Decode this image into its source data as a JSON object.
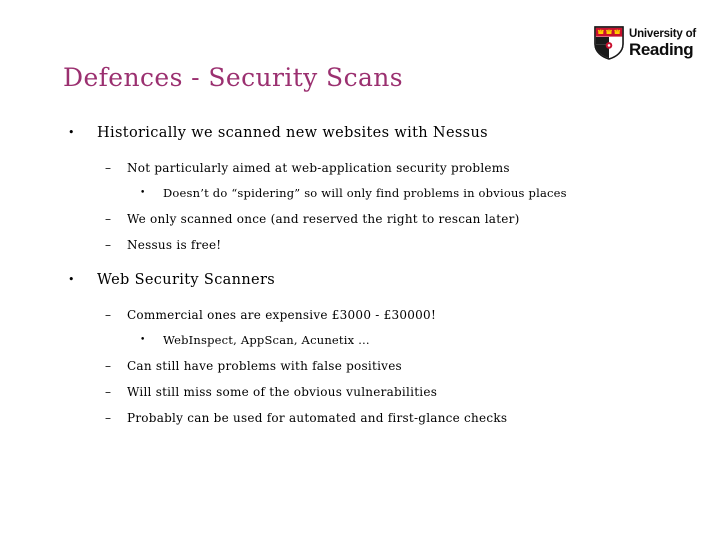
{
  "slide": {
    "title": "Defences - Security Scans",
    "title_color": "#9b3070",
    "background_color": "#ffffff",
    "text_color": "#000000"
  },
  "logo": {
    "name": "university-of-reading-logo",
    "line1": "University of",
    "line2": "Reading",
    "crest_colors": {
      "chief_red": "#c8102e",
      "crown_gold": "#ffcc00",
      "field_black": "#1a1a1a",
      "field_white": "#ffffff",
      "charge_red": "#c8102e"
    }
  },
  "content": {
    "bullets": [
      {
        "level": 1,
        "marker": "•",
        "text": "Historically we scanned new websites with Nessus"
      },
      {
        "level": 2,
        "marker": "–",
        "text": "Not particularly aimed at web-application security problems"
      },
      {
        "level": 3,
        "marker": "•",
        "text": "Doesn’t do “spidering” so will only find problems in obvious places"
      },
      {
        "level": 2,
        "marker": "–",
        "text": "We only scanned once (and reserved the right to rescan later)"
      },
      {
        "level": 2,
        "marker": "–",
        "text": "Nessus is free!"
      },
      {
        "level": 1,
        "marker": "•",
        "text": "Web Security Scanners"
      },
      {
        "level": 2,
        "marker": "–",
        "text": "Commercial ones are expensive £3000 - £30000!"
      },
      {
        "level": 3,
        "marker": "•",
        "text": "WebInspect, AppScan, Acunetix …"
      },
      {
        "level": 2,
        "marker": "–",
        "text": "Can still have problems with false positives"
      },
      {
        "level": 2,
        "marker": "–",
        "text": "Will still miss some of the obvious vulnerabilities"
      },
      {
        "level": 2,
        "marker": "–",
        "text": "Probably can be used for automated and first-glance checks"
      }
    ]
  }
}
